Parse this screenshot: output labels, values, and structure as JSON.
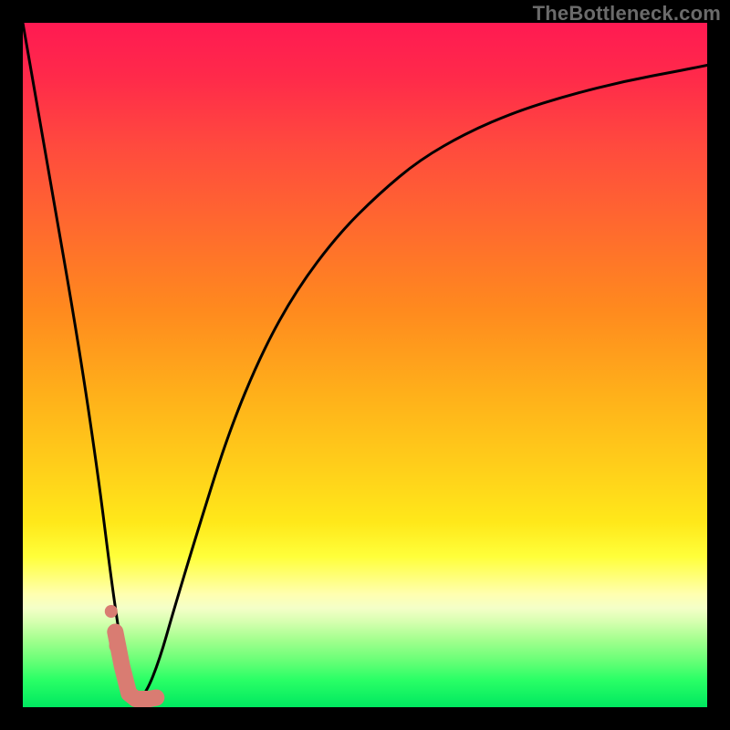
{
  "watermark": "TheBottleneck.com",
  "colors": {
    "background": "#000000",
    "curve": "#000000",
    "marker": "#d97c72",
    "gradient_top": "#ff1a52",
    "gradient_bottom": "#00e860"
  },
  "chart_data": {
    "type": "line",
    "title": "",
    "xlabel": "",
    "ylabel": "",
    "xlim": [
      0,
      100
    ],
    "ylim": [
      0,
      100
    ],
    "series": [
      {
        "name": "bottleneck-curve",
        "x": [
          0,
          4,
          8,
          11,
          13,
          14.5,
          15.5,
          16.5,
          18,
          20,
          22,
          25,
          30,
          35,
          40,
          46,
          52,
          58,
          65,
          72,
          80,
          88,
          96,
          100
        ],
        "values": [
          100,
          77,
          54,
          34,
          18,
          8,
          2,
          1,
          2,
          7,
          14,
          24,
          40,
          52,
          61,
          69,
          75,
          80,
          84,
          87,
          89.5,
          91.5,
          93,
          93.8
        ]
      }
    ],
    "markers": {
      "name": "optimal-region",
      "x": [
        13.5,
        14.5,
        15.5,
        16.5,
        17.5,
        18.5,
        19.5
      ],
      "values": [
        11,
        6,
        2,
        1.2,
        1.2,
        1.2,
        1.4
      ]
    },
    "gradient_bands": [
      {
        "pos": 0.0,
        "color": "#ff1a52"
      },
      {
        "pos": 0.3,
        "color": "#ff6a2e"
      },
      {
        "pos": 0.55,
        "color": "#ffb21a"
      },
      {
        "pos": 0.78,
        "color": "#ffff3a"
      },
      {
        "pos": 0.9,
        "color": "#a6ff90"
      },
      {
        "pos": 1.0,
        "color": "#00e860"
      }
    ]
  }
}
